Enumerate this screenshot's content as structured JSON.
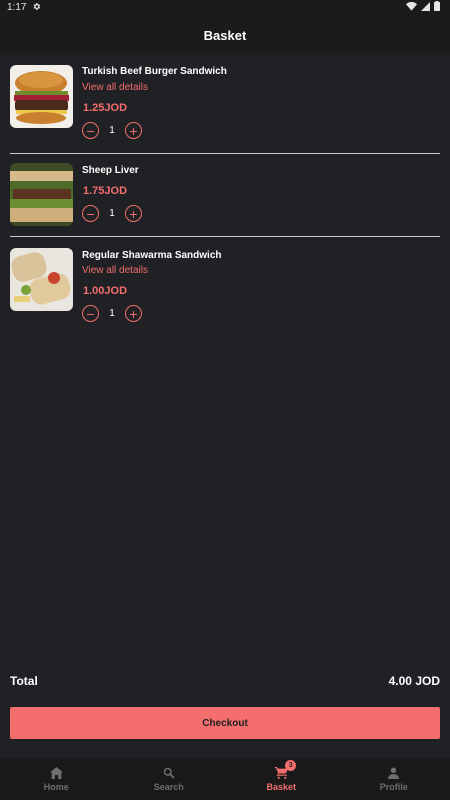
{
  "status_bar": {
    "time": "1:17"
  },
  "header": {
    "title": "Basket"
  },
  "items": [
    {
      "name": "Turkish Beef Burger Sandwich",
      "details_link": "View all details",
      "price": "1.25JOD",
      "quantity": "1",
      "image": "beef-burger"
    },
    {
      "name": "Sheep Liver",
      "details_link": "",
      "price": "1.75JOD",
      "quantity": "1",
      "image": "liver-sandwich"
    },
    {
      "name": "Regular Shawarma Sandwich",
      "details_link": "View all details",
      "price": "1.00JOD",
      "quantity": "1",
      "image": "shawarma-wrap"
    }
  ],
  "summary": {
    "total_label": "Total",
    "total_value": "4.00 JOD"
  },
  "checkout_label": "Checkout",
  "nav": {
    "items": [
      {
        "label": "Home",
        "icon": "home-icon"
      },
      {
        "label": "Search",
        "icon": "search-icon"
      },
      {
        "label": "Basket",
        "icon": "cart-icon",
        "badge": "3"
      },
      {
        "label": "Profile",
        "icon": "person-icon"
      }
    ],
    "active": "Basket"
  },
  "colors": {
    "accent": "#f46e6e",
    "background": "#202124",
    "bar": "#1b1b1d"
  }
}
